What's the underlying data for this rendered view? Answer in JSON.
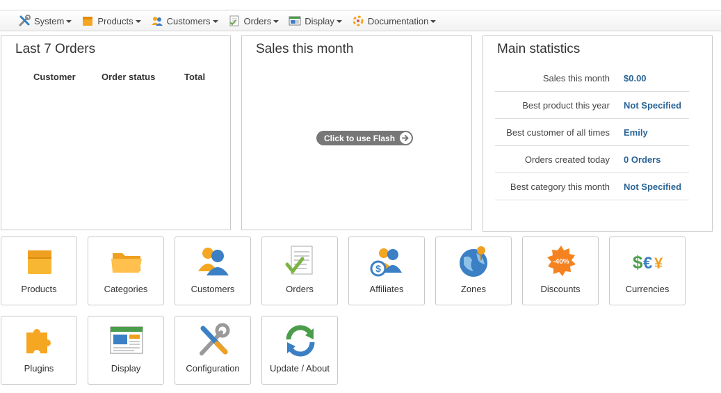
{
  "nav": {
    "items": [
      {
        "label": "System",
        "icon": "tools-icon"
      },
      {
        "label": "Products",
        "icon": "box-icon"
      },
      {
        "label": "Customers",
        "icon": "users-icon"
      },
      {
        "label": "Orders",
        "icon": "document-icon"
      },
      {
        "label": "Display",
        "icon": "window-icon"
      },
      {
        "label": "Documentation",
        "icon": "lifebuoy-icon"
      }
    ]
  },
  "orders_panel": {
    "title": "Last 7 Orders",
    "columns": [
      "Customer",
      "Order status",
      "Total"
    ]
  },
  "sales_panel": {
    "title": "Sales this month",
    "flash_label": "Click to use Flash"
  },
  "stats_panel": {
    "title": "Main statistics",
    "rows": [
      {
        "label": "Sales this month",
        "value": "$0.00"
      },
      {
        "label": "Best product this year",
        "value": "Not Specified"
      },
      {
        "label": "Best customer of all times",
        "value": "Emily"
      },
      {
        "label": "Orders created today",
        "value": "0 Orders"
      },
      {
        "label": "Best category this month",
        "value": "Not Specified"
      }
    ]
  },
  "tiles": [
    {
      "label": "Products",
      "icon": "box-icon"
    },
    {
      "label": "Categories",
      "icon": "folder-icon"
    },
    {
      "label": "Customers",
      "icon": "users-icon"
    },
    {
      "label": "Orders",
      "icon": "document-check-icon"
    },
    {
      "label": "Affiliates",
      "icon": "affiliate-icon"
    },
    {
      "label": "Zones",
      "icon": "globe-icon"
    },
    {
      "label": "Discounts",
      "icon": "discount-badge-icon"
    },
    {
      "label": "Currencies",
      "icon": "currency-icon"
    },
    {
      "label": "Plugins",
      "icon": "puzzle-icon"
    },
    {
      "label": "Display",
      "icon": "window-icon"
    },
    {
      "label": "Configuration",
      "icon": "tools-icon"
    },
    {
      "label": "Update / About",
      "icon": "refresh-icon"
    }
  ],
  "discount_badge_text": "-40%",
  "colors": {
    "link": "#2a6496",
    "flash_button": "#777777",
    "border": "#c9c9c9"
  }
}
